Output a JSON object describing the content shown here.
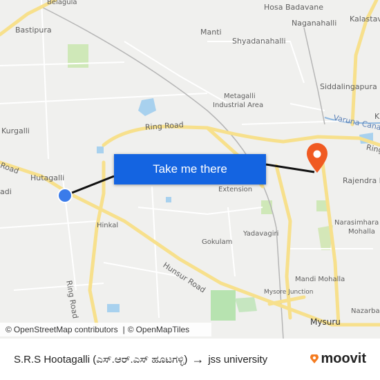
{
  "map": {
    "labels": {
      "belagula": "Belagula",
      "hosa_badavane": "Hosa Badavane",
      "naganahalli": "Naganahalli",
      "kalastav": "Kalastav",
      "bastipura": "Bastipura",
      "manti": "Manti",
      "shyadanahalli": "Shyadanahalli",
      "siddalingapura": "Siddalingapura",
      "metagalli": "Metagalli",
      "industrial_area": "Industrial Area",
      "kurgalli": "Kurgalli",
      "ring_road_top": "Ring Road",
      "varuna_canal": "Varuna Cana",
      "ring_right": "Ring",
      "road_left": "Road",
      "hutagalli": "Hutagalli",
      "adi": "adi",
      "rajendra_n": "Rajendra N",
      "extension": "Extension",
      "hinkal": "Hinkal",
      "yadavagiri": "Yadavagiri",
      "narasimhara": "Narasimhara",
      "mohalla": "Mohalla",
      "gokulam": "Gokulam",
      "ring_road_vertical": "Ring Road",
      "hunsur_road": "Hunsur Road",
      "mandi_mohalla": "Mandi Mohalla",
      "mysore_junction": "Mysore Junction",
      "mysuru": "Mysuru",
      "nazarba": "Nazarba",
      "k": "K"
    },
    "cta_label": "Take me there",
    "attribution": {
      "c1": "©",
      "osm_contributors": "OpenStreetMap contributors",
      "sep": "|",
      "c2": "©",
      "openmaptiles": "OpenMapTiles"
    }
  },
  "footer": {
    "origin": "S.R.S Hootagalli (ಎಸ್.ಆರ್.ಎಸ್ ಹೂಟಗಳ್ಳಿ)",
    "arrow": "→",
    "destination": "jss university",
    "brand": "moovit"
  },
  "colors": {
    "accent": "#1464e1",
    "origin_dot": "#3a7bea",
    "destination_pin": "#f05a22",
    "brand_orange": "#f47b20"
  }
}
